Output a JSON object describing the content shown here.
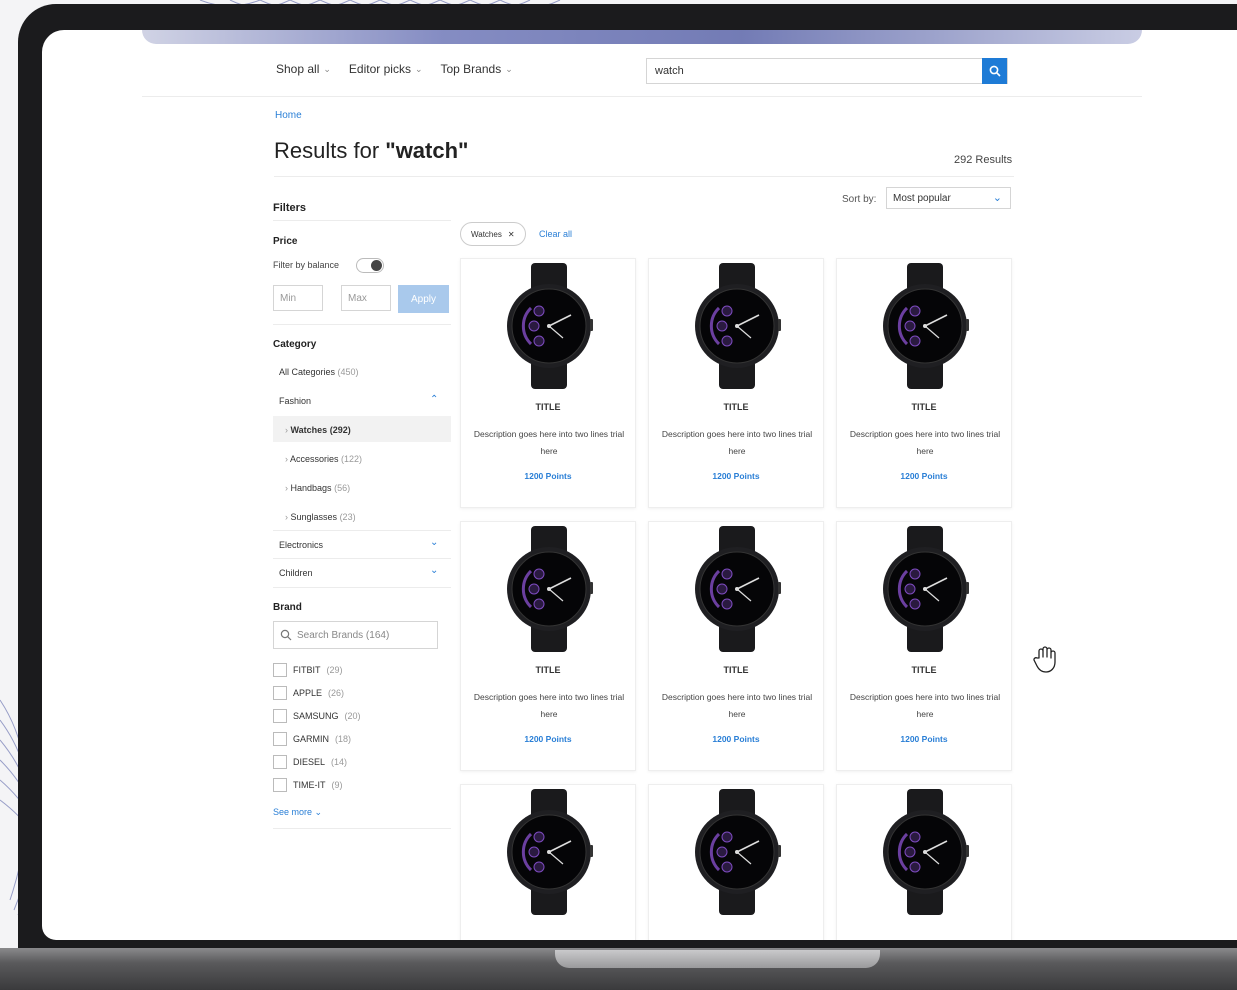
{
  "nav": {
    "items": [
      {
        "label": "Shop all"
      },
      {
        "label": "Editor picks"
      },
      {
        "label": "Top Brands"
      }
    ]
  },
  "search": {
    "value": "watch",
    "clear_icon": "close-icon",
    "button_icon": "search-icon"
  },
  "breadcrumb": "Home",
  "results": {
    "title_prefix": "Results for ",
    "query": "\"watch\"",
    "count": "292 Results"
  },
  "sort": {
    "label": "Sort by:",
    "selected": "Most popular"
  },
  "filters": {
    "title": "Filters",
    "price": {
      "label": "Price",
      "filter_by_balance": "Filter by balance",
      "min_placeholder": "Min",
      "max_placeholder": "Max",
      "apply": "Apply"
    },
    "category": {
      "label": "Category",
      "items": [
        {
          "label": "All Categories",
          "count": "(450)"
        },
        {
          "label": "Fashion",
          "count": ""
        },
        {
          "label": "Watches (292)",
          "count": ""
        },
        {
          "label": "Accessories",
          "count": "(122)"
        },
        {
          "label": "Handbags",
          "count": "(56)"
        },
        {
          "label": "Sunglasses",
          "count": "(23)"
        },
        {
          "label": "Electronics",
          "count": ""
        },
        {
          "label": "Children",
          "count": ""
        }
      ]
    },
    "brand": {
      "label": "Brand",
      "search_placeholder": "Search Brands (164)",
      "items": [
        {
          "label": "FITBIT",
          "count": "(29)"
        },
        {
          "label": "APPLE",
          "count": "(26)"
        },
        {
          "label": "SAMSUNG",
          "count": "(20)"
        },
        {
          "label": "GARMIN",
          "count": "(18)"
        },
        {
          "label": "DIESEL",
          "count": "(14)"
        },
        {
          "label": "TIME-IT",
          "count": "(9)"
        }
      ],
      "see_more": "See more"
    }
  },
  "active_filters": {
    "chip": "Watches",
    "clear_all": "Clear all"
  },
  "products": [
    {
      "title": "TITLE",
      "desc": "Description goes here into two lines trial here",
      "price": "1200 Points"
    },
    {
      "title": "TITLE",
      "desc": "Description goes here into two lines trial here",
      "price": "1200 Points"
    },
    {
      "title": "TITLE",
      "desc": "Description goes here into two lines trial here",
      "price": "1200 Points"
    },
    {
      "title": "TITLE",
      "desc": "Description goes here into two lines trial here",
      "price": "1200 Points"
    },
    {
      "title": "TITLE",
      "desc": "Description goes here into two lines trial here",
      "price": "1200 Points"
    },
    {
      "title": "TITLE",
      "desc": "Description goes here into two lines trial here",
      "price": "1200 Points"
    },
    {
      "title": "",
      "desc": "",
      "price": ""
    },
    {
      "title": "",
      "desc": "",
      "price": ""
    },
    {
      "title": "",
      "desc": "",
      "price": ""
    }
  ],
  "colors": {
    "accent": "#1e7bd6",
    "link": "#2a7fd6"
  }
}
